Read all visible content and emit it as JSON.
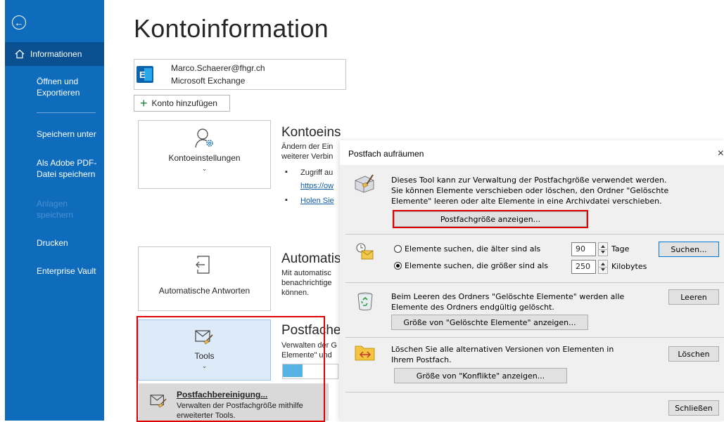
{
  "sidebar": {
    "back_icon": "back-arrow-icon",
    "items": {
      "informationen": "Informationen",
      "oeffnen": "Öffnen und\nExportieren",
      "speichern_unter": "Speichern unter",
      "adobe_pdf": "Als Adobe PDF-\nDatei speichern",
      "anlagen": "Anlagen\nspeichern",
      "drucken": "Drucken",
      "enterprise_vault": "Enterprise Vault"
    },
    "colors": {
      "background": "#0f6cbd",
      "selected": "#0a4f8f"
    }
  },
  "main": {
    "title": "Kontoinformation",
    "account": {
      "email": "Marco.Schaerer@fhgr.ch",
      "type": "Microsoft Exchange"
    },
    "add_account": "Konto hinzufügen",
    "tiles": {
      "account_settings": "Kontoeinstellungen",
      "auto_replies": "Automatische Antworten",
      "tools": "Tools"
    },
    "sections": {
      "account_settings_title": "Kontoeins",
      "account_settings_text": "Ändern der Ein\nweiterer Verbin",
      "bullet1": "Zugriff au",
      "bullet1_link": "https://ow",
      "bullet2_link": "Holen Sie",
      "auto_title": "Automatis",
      "auto_text": "Mit automatisc\nbenachrichtige\nkönnen.",
      "mailbox_title": "Postfache",
      "mailbox_text": "Verwalten der G\nElemente\" und"
    },
    "tools_menu": {
      "title": "Postfachbereinigung...",
      "desc": "Verwalten der Postfachgröße mithilfe\nerweiterter Tools."
    }
  },
  "dialog": {
    "title": "Postfach aufräumen",
    "close": "×",
    "intro": "Dieses Tool kann zur Verwaltung der Postfachgröße verwendet werden.\nSie können Elemente verschieben oder löschen, den Ordner \"Gelöschte\nElemente\" leeren oder alte Elemente in eine Archivdatei verschieben.",
    "show_size_btn": "Postfachgröße anzeigen...",
    "find_older_label": "Elemente suchen, die älter sind als",
    "find_older_value": "90",
    "find_older_unit": "Tage",
    "find_larger_label": "Elemente suchen, die größer sind als",
    "find_larger_value": "250",
    "find_larger_unit": "Kilobytes",
    "search_btn": "Suchen...",
    "deleted_text": "Beim Leeren des Ordners \"Gelöschte Elemente\" werden alle\nElemente des Ordners endgültig gelöscht.",
    "empty_btn": "Leeren",
    "deleted_size_btn": "Größe von \"Gelöschte Elemente\" anzeigen...",
    "conflicts_text": "Löschen Sie alle alternativen Versionen von Elementen in\nIhrem Postfach.",
    "delete_btn": "Löschen",
    "conflicts_size_btn": "Größe von \"Konflikte\" anzeigen...",
    "close_btn": "Schließen",
    "highlight_color": "#e00000"
  }
}
